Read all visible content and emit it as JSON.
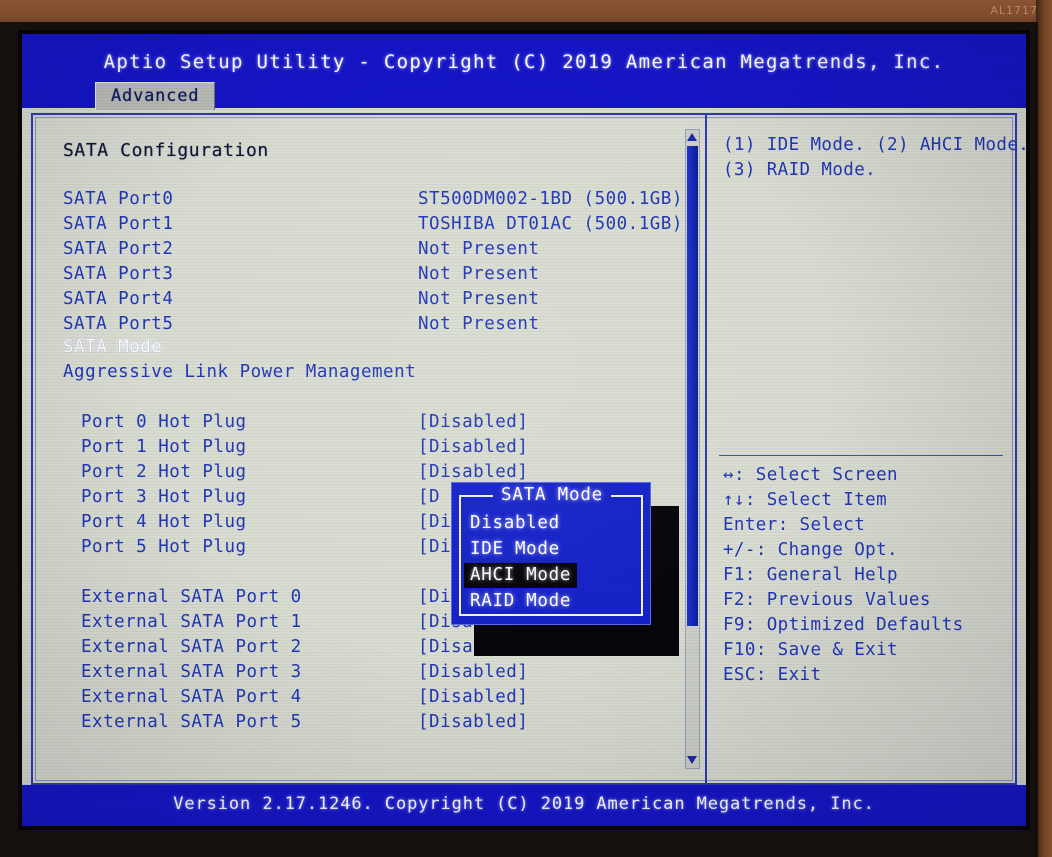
{
  "photo": {
    "monitor_label": "AL1717"
  },
  "header": {
    "title": "Aptio Setup Utility - Copyright (C) 2019 American Megatrends, Inc.",
    "tabs": [
      {
        "label": "Advanced",
        "active": true
      }
    ]
  },
  "main": {
    "section_title": "SATA Configuration",
    "ports": [
      {
        "label": "SATA Port0",
        "value": "ST500DM002-1BD  (500.1GB)"
      },
      {
        "label": "SATA Port1",
        "value": "TOSHIBA DT01AC  (500.1GB)"
      },
      {
        "label": "SATA Port2",
        "value": "Not Present"
      },
      {
        "label": "SATA Port3",
        "value": "Not Present"
      },
      {
        "label": "SATA Port4",
        "value": "Not Present"
      },
      {
        "label": "SATA Port5",
        "value": "Not Present"
      }
    ],
    "settings": [
      {
        "label": "SATA Mode",
        "value": "",
        "selected": true
      },
      {
        "label": "Aggressive Link Power Management",
        "value": "",
        "selected": false
      }
    ],
    "hot_plug": [
      {
        "label": "Port 0 Hot Plug",
        "value": "[Disabled]"
      },
      {
        "label": "Port 1 Hot Plug",
        "value": "[Disabled]"
      },
      {
        "label": "Port 2 Hot Plug",
        "value": "[Disabled]"
      },
      {
        "label": "Port 3 Hot Plug",
        "value": "[D"
      },
      {
        "label": "Port 4 Hot Plug",
        "value": "[Disabled]"
      },
      {
        "label": "Port 5 Hot Plug",
        "value": "[Disabled]"
      }
    ],
    "external_ports": [
      {
        "label": "External SATA Port 0",
        "value": "[Disabled]"
      },
      {
        "label": "External SATA Port 1",
        "value": "[Disabled]"
      },
      {
        "label": "External SATA Port 2",
        "value": "[Disabled]"
      },
      {
        "label": "External SATA Port 3",
        "value": "[Disabled]"
      },
      {
        "label": "External SATA Port 4",
        "value": "[Disabled]"
      },
      {
        "label": "External SATA Port 5",
        "value": "[Disabled]"
      }
    ]
  },
  "scrollbar": {
    "up_arrow": "scroll-up-arrow-icon",
    "down_arrow": "scroll-down-arrow-icon"
  },
  "help": {
    "lines": [
      "(1) IDE Mode. (2) AHCI Mode.",
      "(3) RAID Mode."
    ]
  },
  "keys": [
    {
      "key": "↔",
      "action": ": Select Screen"
    },
    {
      "key": "↑↓",
      "action": ": Select Item"
    },
    {
      "key": "Enter",
      "action": ": Select"
    },
    {
      "key": "+/-",
      "action": ": Change Opt."
    },
    {
      "key": "F1",
      "action": ": General Help"
    },
    {
      "key": "F2",
      "action": ": Previous Values"
    },
    {
      "key": "F9",
      "action": ": Optimized Defaults"
    },
    {
      "key": "F10",
      "action": ": Save & Exit"
    },
    {
      "key": "ESC",
      "action": ": Exit"
    }
  ],
  "popup": {
    "title": "SATA Mode",
    "options": [
      {
        "label": "Disabled",
        "active": false
      },
      {
        "label": "IDE Mode",
        "active": false
      },
      {
        "label": "AHCI Mode",
        "active": true
      },
      {
        "label": "RAID Mode",
        "active": false
      }
    ]
  },
  "footer": {
    "text": "Version 2.17.1246. Copyright (C) 2019 American Megatrends, Inc."
  }
}
